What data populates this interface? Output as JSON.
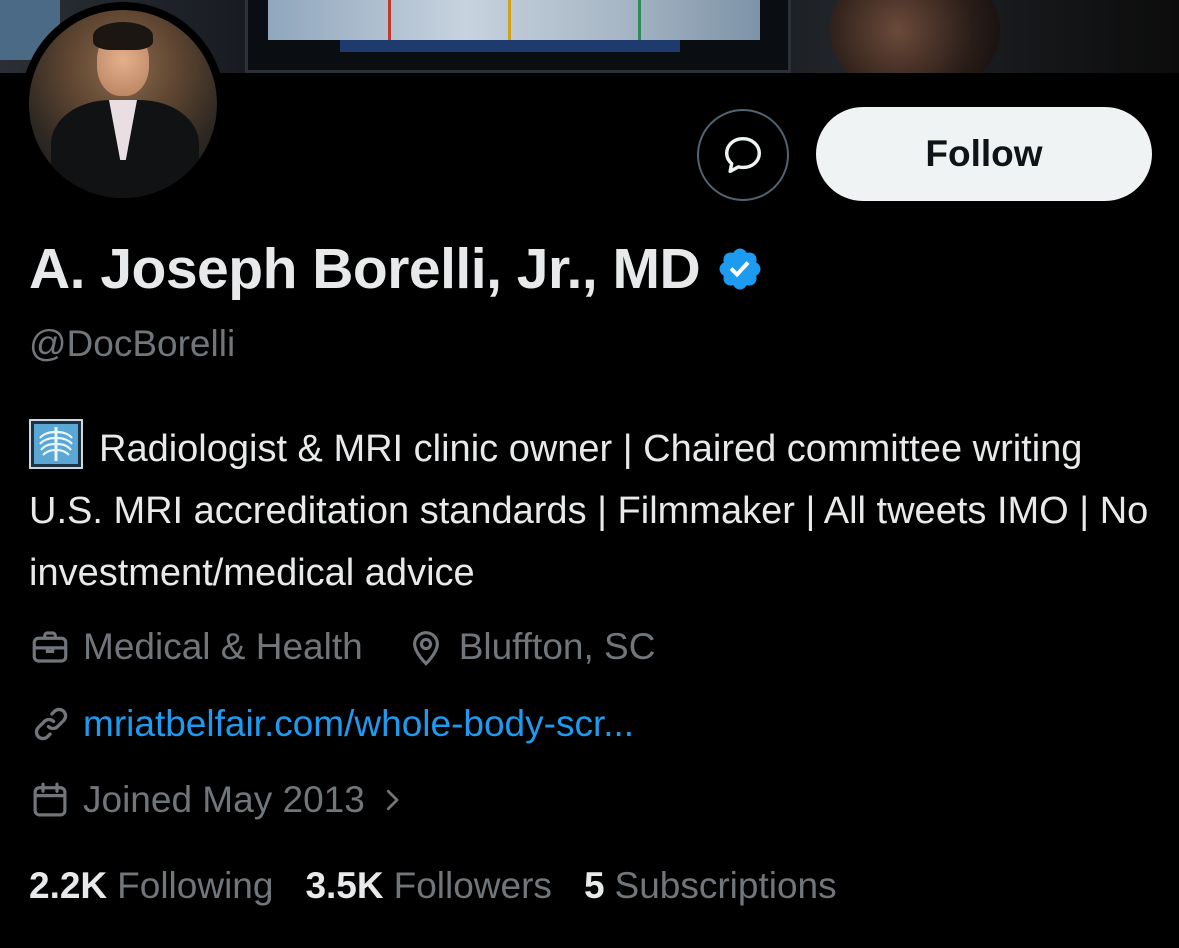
{
  "profile": {
    "name": "A. Joseph Borelli, Jr., MD",
    "handle": "@DocBorelli",
    "verified_color": "#1d9bf0",
    "bio": "Radiologist & MRI clinic owner | Chaired committee writing U.S. MRI accreditation standards | Filmmaker | All tweets IMO | No investment/medical advice",
    "bio_emoji": "x-ray-icon",
    "category": "Medical & Health",
    "location": "Bluffton, SC",
    "website": "mriatbelfair.com/whole-body-scr...",
    "joined": "Joined May 2013",
    "stats": {
      "following_count": "2.2K",
      "following_label": "Following",
      "followers_count": "3.5K",
      "followers_label": "Followers",
      "subscriptions_count": "5",
      "subscriptions_label": "Subscriptions"
    }
  },
  "actions": {
    "follow_label": "Follow",
    "message_icon": "message-icon"
  },
  "colors": {
    "background": "#000000",
    "link": "#1d9bf0",
    "secondary_text": "#71767b",
    "follow_bg": "#eff3f4"
  }
}
